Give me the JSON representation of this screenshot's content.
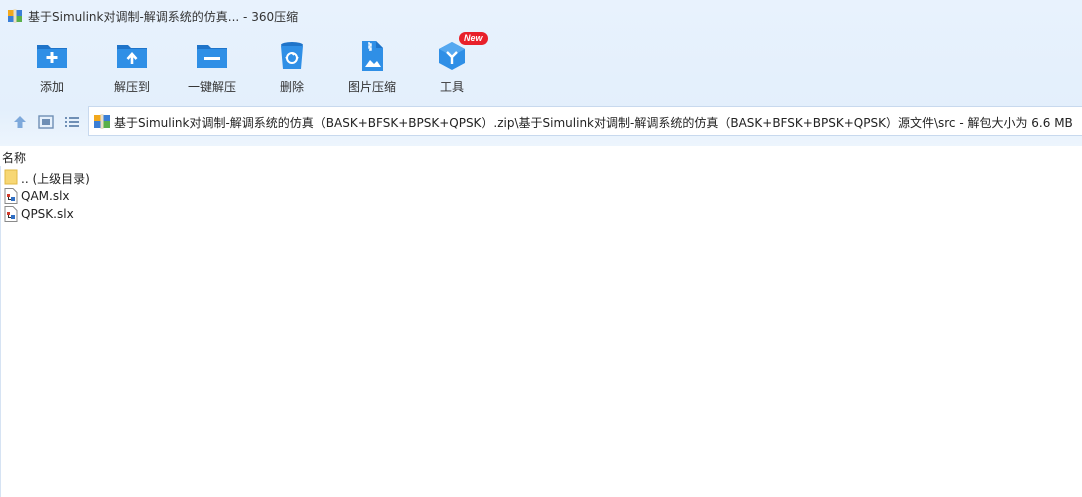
{
  "window": {
    "title": "基于Simulink对调制-解调系统的仿真... - 360压缩"
  },
  "toolbar": {
    "items": [
      {
        "label": "添加",
        "icon": "folder-add-icon"
      },
      {
        "label": "解压到",
        "icon": "folder-extract-icon"
      },
      {
        "label": "一键解压",
        "icon": "folder-quick-extract-icon"
      },
      {
        "label": "删除",
        "icon": "trash-icon"
      },
      {
        "label": "图片压缩",
        "icon": "image-compress-icon"
      },
      {
        "label": "工具",
        "icon": "tools-cube-icon",
        "badge": "New"
      }
    ]
  },
  "nav": {
    "address": "基于Simulink对调制-解调系统的仿真（BASK+BFSK+BPSK+QPSK）.zip\\基于Simulink对调制-解调系统的仿真（BASK+BFSK+BPSK+QPSK）源文件\\src - 解包大小为 6.6 MB"
  },
  "list": {
    "column_name": "名称",
    "rows": [
      {
        "name": ".. (上级目录)",
        "type": "folder"
      },
      {
        "name": "QAM.slx",
        "type": "file"
      },
      {
        "name": "QPSK.slx",
        "type": "file"
      }
    ]
  },
  "colors": {
    "accent": "#2f8fe6",
    "accent_dark": "#1f74c9",
    "badge": "#e8202a",
    "folder": "#f7d774"
  }
}
